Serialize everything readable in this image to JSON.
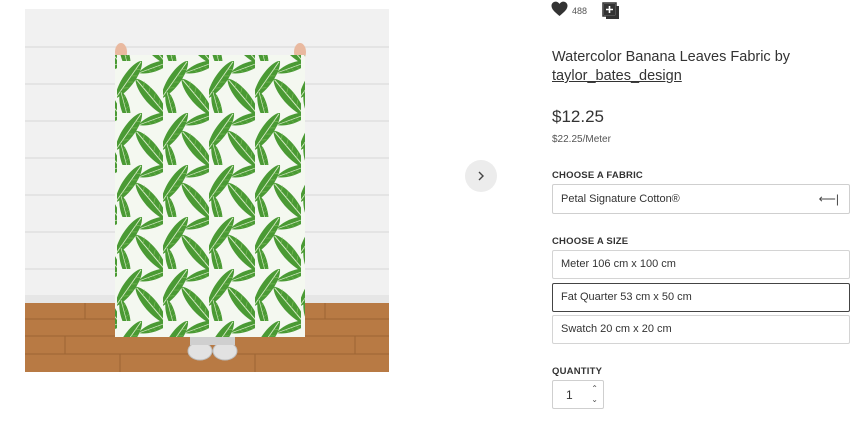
{
  "product": {
    "title": "Watercolor Banana Leaves Fabric by",
    "designer": "taylor_bates_design",
    "price": "$12.25",
    "unit_price": "$22.25/Meter",
    "favorites_count": "488"
  },
  "fabric": {
    "label": "CHOOSE A FABRIC",
    "selected": "Petal Signature Cotton®"
  },
  "size": {
    "label": "CHOOSE A SIZE",
    "options": [
      "Meter 106 cm x 100 cm",
      "Fat Quarter 53 cm x 50 cm",
      "Swatch 20 cm x 20 cm"
    ],
    "selected_index": 1
  },
  "quantity": {
    "label": "QUANTITY",
    "value": "1"
  },
  "icons": {
    "favorite": "heart-icon",
    "collection": "add-to-collection-icon",
    "next": "chevron-right-icon",
    "select": "select-arrow-icon",
    "qty_up": "chevron-up-icon",
    "qty_down": "chevron-down-icon"
  },
  "colors": {
    "text": "#333333",
    "border": "#cfcfcf",
    "selected_border": "#444444",
    "leaf": "#3f8a2e"
  }
}
